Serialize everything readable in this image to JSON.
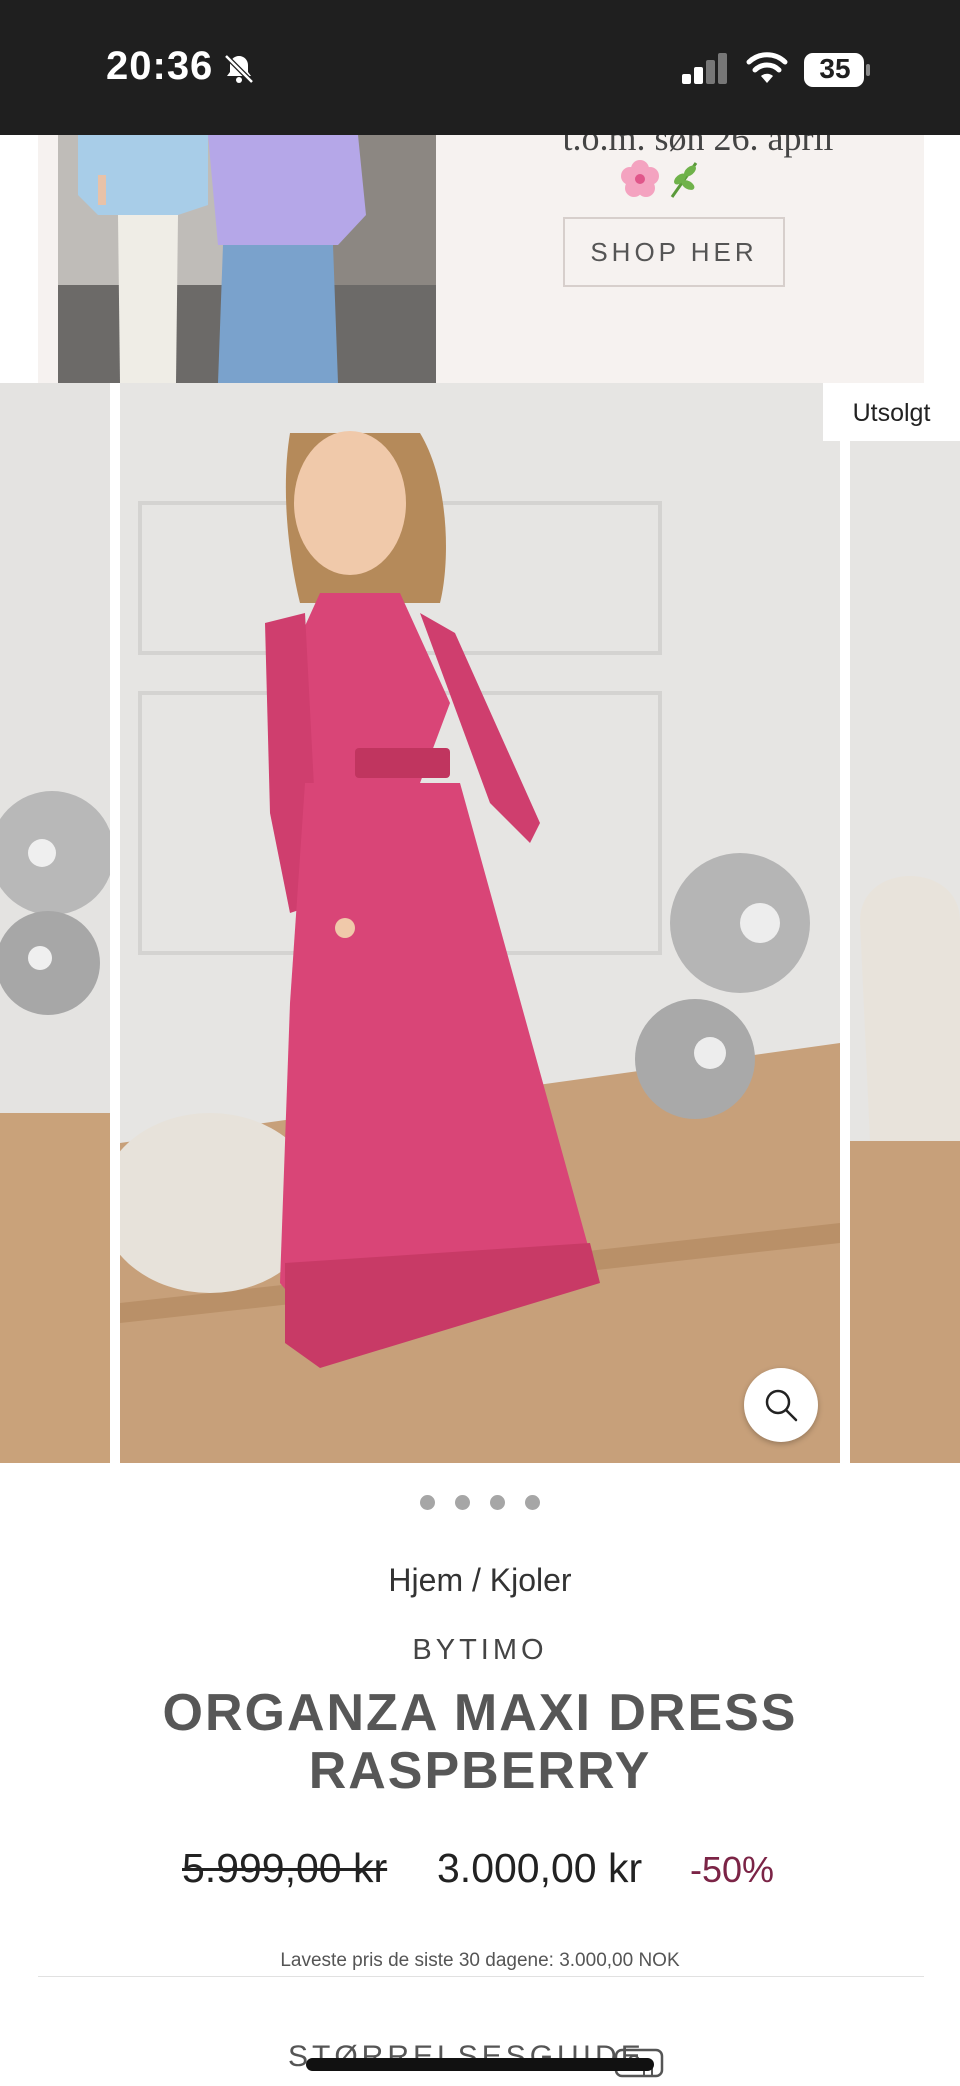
{
  "status_bar": {
    "time": "20:36",
    "battery": "35",
    "icons": [
      "bell-slash-icon",
      "cellular-signal-icon",
      "wifi-icon",
      "battery-icon"
    ]
  },
  "promo": {
    "text": "t.o.m. søn 26. april",
    "emoji": "🌸🌿",
    "button_label": "SHOP HER"
  },
  "carousel": {
    "sold_badge": "Utsolgt",
    "total_slides": 4,
    "active_slide": 2,
    "dress_color": "#d94577"
  },
  "breadcrumb": {
    "home": "Hjem",
    "separator": " / ",
    "category": "Kjoler"
  },
  "product": {
    "brand": "BYTIMO",
    "title": "ORGANZA MAXI DRESS RASPBERRY",
    "old_price": "5.999,00 kr",
    "new_price": "3.000,00 kr",
    "discount": "-50%",
    "lowest_price_note": "Laveste pris de siste 30 dagene: 3.000,00 NOK",
    "size_guide_label": "STØRRELSESGUIDE"
  },
  "colors": {
    "discount": "#7b2446",
    "status_bar_bg": "#1f1f1f",
    "promo_bg": "#f6f2f0"
  }
}
